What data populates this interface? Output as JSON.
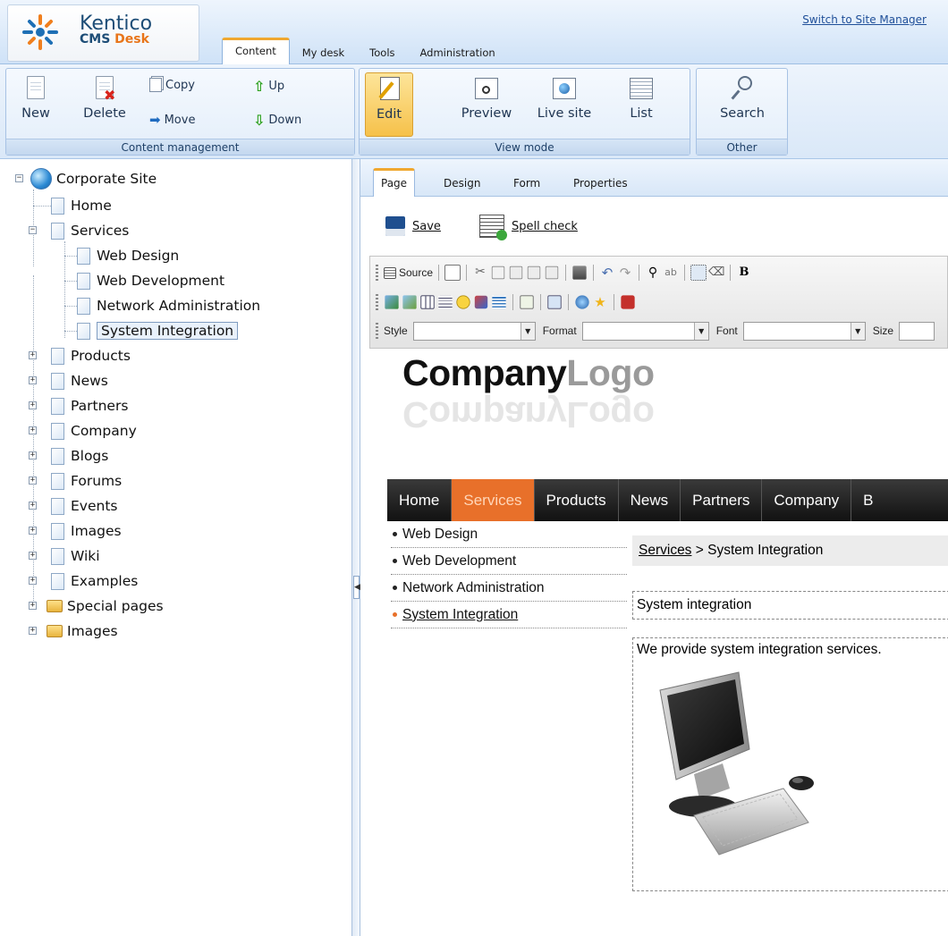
{
  "header": {
    "brand_name": "Kentico",
    "brand_sub_a": "CMS",
    "brand_sub_b": "Desk",
    "switch_link": "Switch to Site Manager",
    "tabs": [
      {
        "label": "Content",
        "active": true
      },
      {
        "label": "My desk",
        "active": false
      },
      {
        "label": "Tools",
        "active": false
      },
      {
        "label": "Administration",
        "active": false
      }
    ]
  },
  "ribbon": {
    "content_management": {
      "label": "Content management",
      "new": "New",
      "delete": "Delete",
      "copy": "Copy",
      "move": "Move",
      "up": "Up",
      "down": "Down"
    },
    "view_mode": {
      "label": "View mode",
      "edit": "Edit",
      "preview": "Preview",
      "live_site": "Live site",
      "list": "List"
    },
    "other": {
      "label": "Other",
      "search": "Search"
    }
  },
  "tree": {
    "root": "Corporate Site",
    "home": "Home",
    "services": "Services",
    "services_children": [
      "Web Design",
      "Web Development",
      "Network Administration",
      "System Integration"
    ],
    "others": [
      "Products",
      "News",
      "Partners",
      "Company",
      "Blogs",
      "Forums",
      "Events",
      "Images",
      "Wiki",
      "Examples"
    ],
    "folders": [
      "Special pages",
      "Images"
    ],
    "selected": "System Integration"
  },
  "subtabs": [
    {
      "label": "Page",
      "active": true
    },
    {
      "label": "Design",
      "active": false
    },
    {
      "label": "Form",
      "active": false
    },
    {
      "label": "Properties",
      "active": false
    }
  ],
  "editbar": {
    "save": "Save",
    "spell_check": "Spell check"
  },
  "editor": {
    "source": "Source",
    "style_label": "Style",
    "format_label": "Format",
    "font_label": "Font",
    "size_label": "Size",
    "style_value": "",
    "format_value": "",
    "font_value": "",
    "size_value": ""
  },
  "site": {
    "logo_a": "Company",
    "logo_b": "Logo",
    "nav": [
      "Home",
      "Services",
      "Products",
      "News",
      "Partners",
      "Company",
      "B"
    ],
    "active_nav": "Services",
    "side_menu": [
      "Web Design",
      "Web Development",
      "Network Administration",
      "System Integration"
    ],
    "breadcrumb_link": "Services",
    "breadcrumb_rest": " > System Integration",
    "title": "System integration",
    "body": "We provide system integration services."
  },
  "colors": {
    "accent_orange": "#e8702a",
    "ribbon_blue": "#dae8f8",
    "active_tab_top": "#f0a830"
  }
}
